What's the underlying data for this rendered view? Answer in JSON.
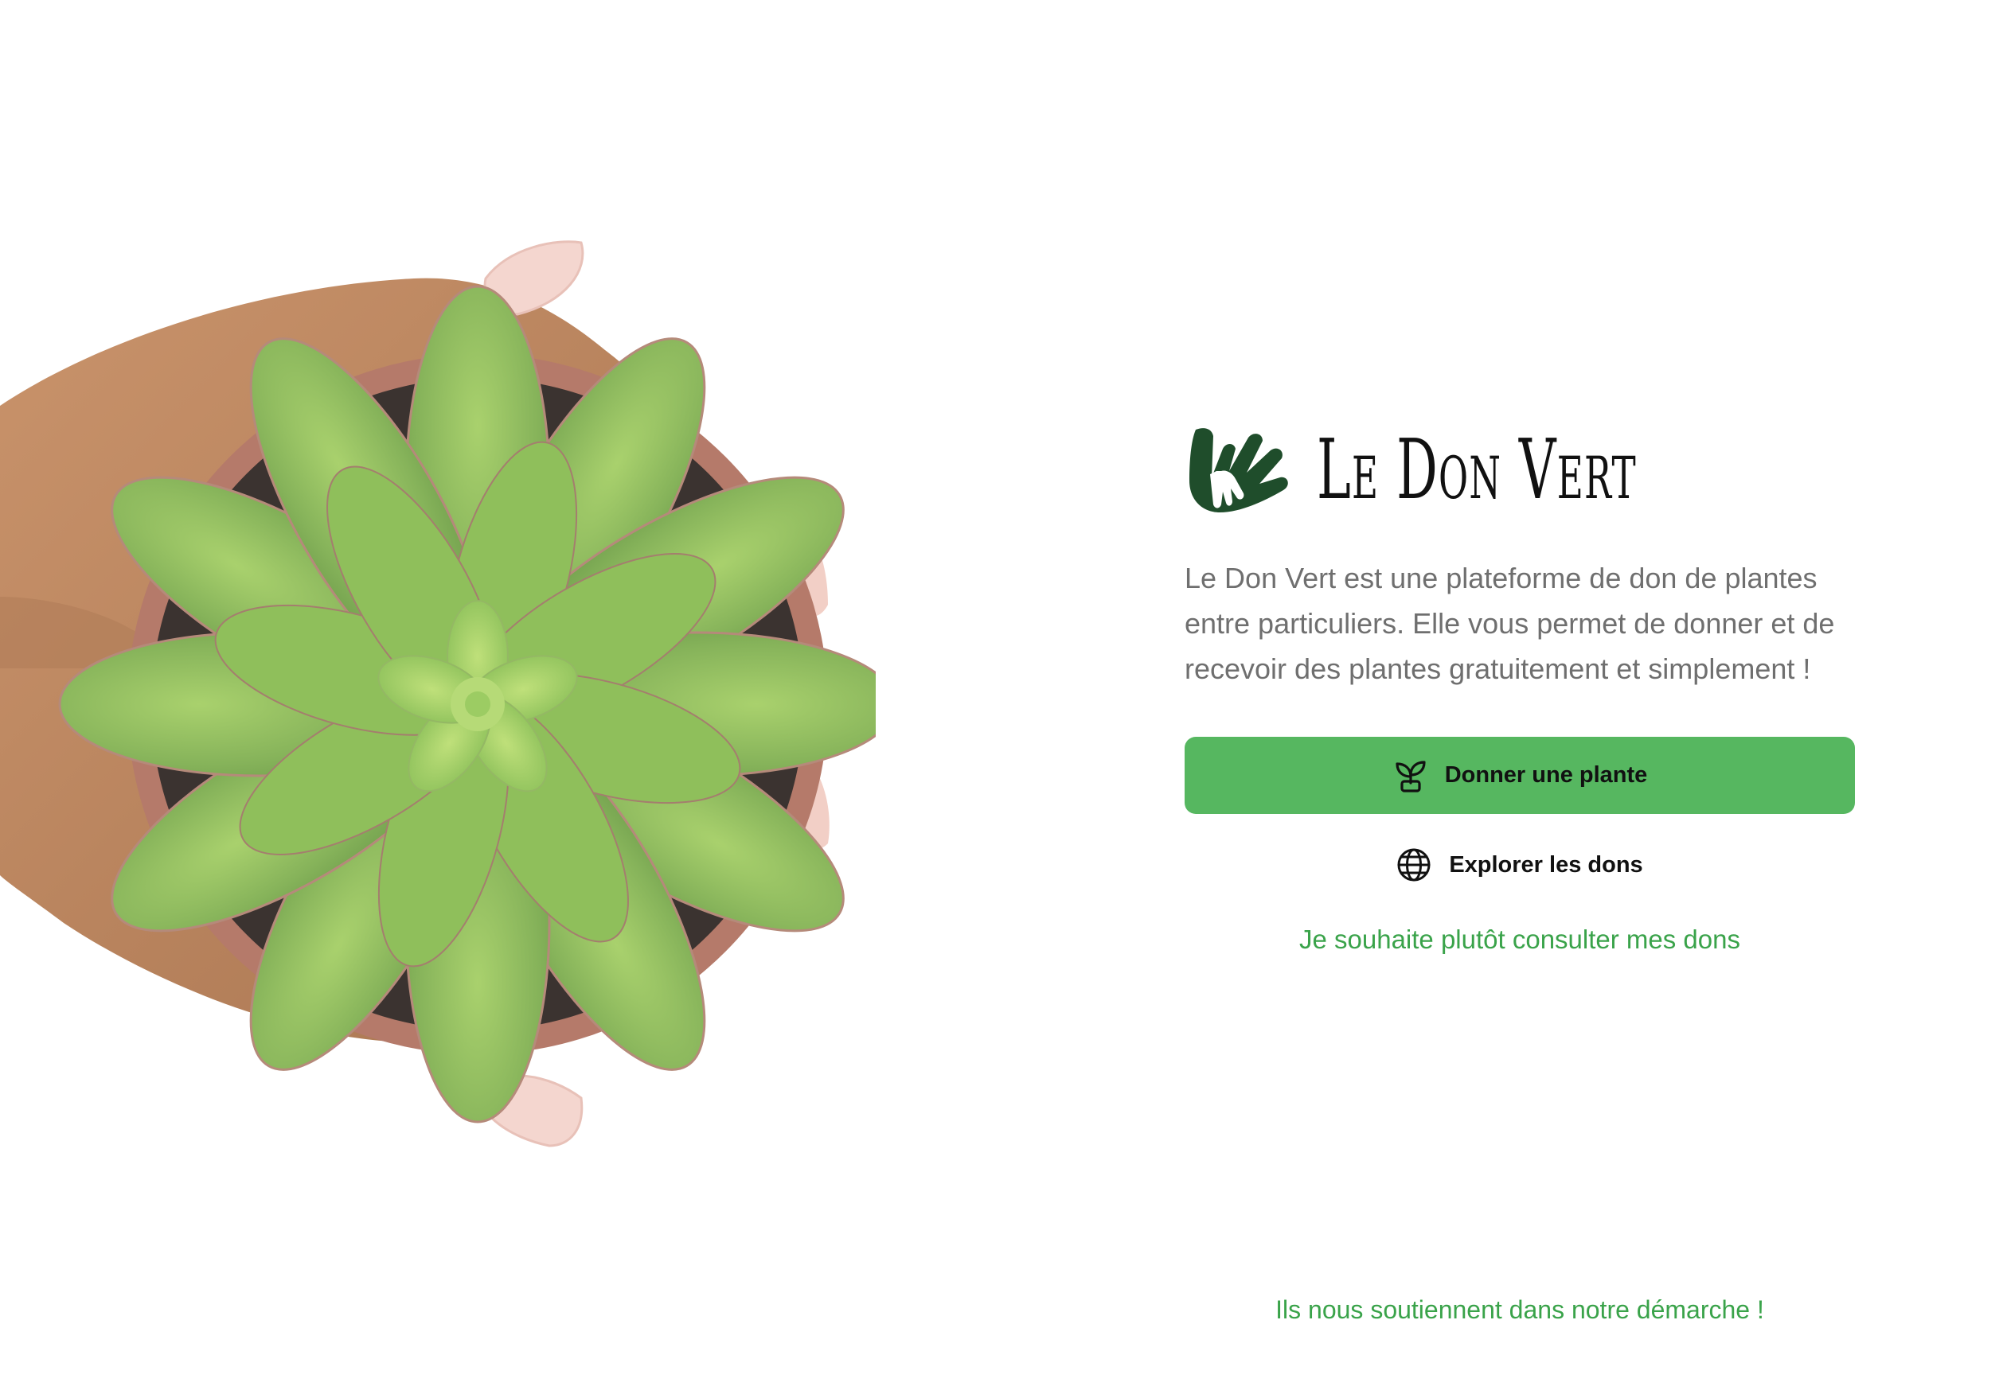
{
  "brand": {
    "name": "Le Don Vert",
    "logo_icon": "hands-leaf-logo"
  },
  "intro": {
    "description": "Le Don Vert est une plateforme de don de plantes entre particuliers. Elle vous permet de donner et de recevoir des plantes gratuitement et simplement !"
  },
  "actions": {
    "give_label": "Donner une plante",
    "give_icon": "sprout-icon",
    "explore_label": "Explorer les dons",
    "explore_icon": "globe-icon",
    "my_donations_link": "Je souhaite plutôt consulter mes dons"
  },
  "footer": {
    "supporters_text": "Ils nous soutiennent dans notre démarche !"
  },
  "colors": {
    "accent": "#56b760",
    "link": "#3aa34a",
    "brand_dark": "#1f4d2b",
    "text_muted": "#6f6f6f"
  }
}
